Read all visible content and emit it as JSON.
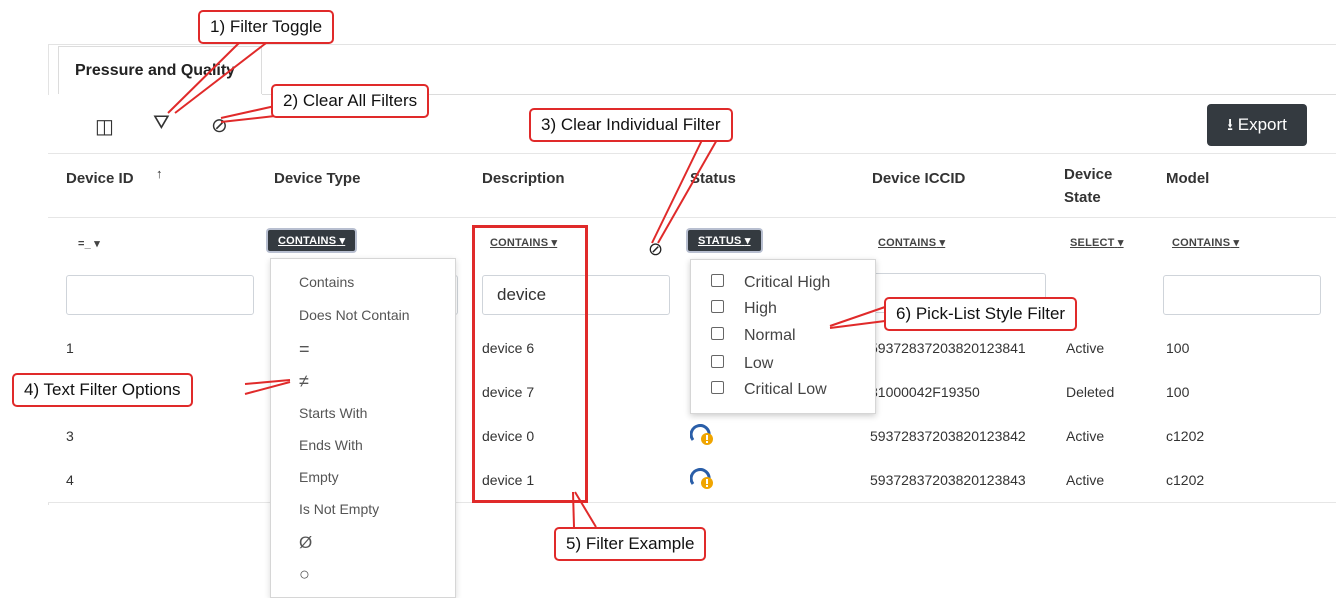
{
  "tab": {
    "label": "Pressure and Quality"
  },
  "toolbar": {
    "columns_icon": "◫",
    "filter_icon": "⛛",
    "clear_icon": "⊘",
    "export_icon": "⭳",
    "export_label": "Export"
  },
  "columns": {
    "device_id": "Device ID",
    "sort_arrow": "↑",
    "device_type": "Device Type",
    "description": "Description",
    "status": "Status",
    "iccid": "Device ICCID",
    "state_line1": "Device",
    "state_line2": "State",
    "model": "Model"
  },
  "filters": {
    "device_id_op": "=_",
    "device_type_op": "CONTAINS",
    "description_op": "CONTAINS",
    "status_op": "STATUS",
    "iccid_op": "CONTAINS",
    "state_op": "SELECT",
    "model_op": "CONTAINS",
    "caret": "▾",
    "description_value": "device",
    "clear_filter_icon": "⊘"
  },
  "rows": [
    {
      "id": "1",
      "description": "device 6",
      "iccid": "59372837203820123841",
      "state": "Active",
      "model": "100"
    },
    {
      "id": "",
      "description": "device 7",
      "iccid": "31000042F19350",
      "state": "Deleted",
      "model": "100"
    },
    {
      "id": "3",
      "description": "device 0",
      "iccid": "59372837203820123842",
      "state": "Active",
      "model": "c1202"
    },
    {
      "id": "4",
      "description": "device 1",
      "iccid": "59372837203820123843",
      "state": "Active",
      "model": "c1202"
    }
  ],
  "text_filter_options": [
    "Contains",
    "Does Not Contain",
    "=",
    "≠",
    "Starts With",
    "Ends With",
    "Empty",
    "Is Not Empty",
    "Ø",
    "○"
  ],
  "status_options": [
    "Critical High",
    "High",
    "Normal",
    "Low",
    "Critical Low"
  ],
  "callouts": {
    "c1": "1) Filter Toggle",
    "c2": "2) Clear All Filters",
    "c3": "3) Clear Individual Filter",
    "c4": "4) Text Filter Options",
    "c5": "5) Filter Example",
    "c6": "6) Pick-List Style Filter"
  },
  "colors": {
    "callout_red": "#e02a2a",
    "export_bg": "#343a40",
    "status_icon_blue": "#2a5ea8",
    "status_icon_orange": "#f0a500"
  }
}
